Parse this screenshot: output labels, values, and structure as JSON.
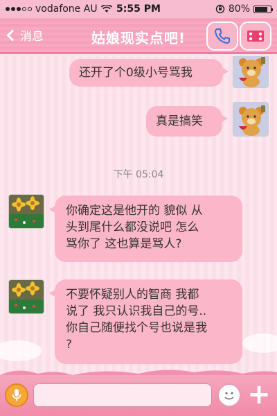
{
  "status_bar": {
    "carrier": "vodafone AU",
    "time": "5:55 PM",
    "battery_percent": "80%",
    "battery_level": 0.8,
    "signal_bars": 3,
    "signal_total": 5
  },
  "nav": {
    "back_label": "消息",
    "title": "姑娘现实点吧!"
  },
  "chat": {
    "timestamp": "下午 05:04",
    "messages": [
      {
        "side": "right",
        "text": "还开了个0级小号骂我"
      },
      {
        "side": "right",
        "text": "真是搞笑"
      },
      {
        "side": "left",
        "lines": [
          "你确定这是他开的 貌似 从",
          "头到尾什么都没说吧 怎么",
          "骂你了 这也算是骂人?"
        ]
      },
      {
        "side": "left",
        "lines": [
          "不要怀疑别人的智商  我都",
          "说了 我只认识我自己的号..",
          "你自己随便找个号也说是我",
          "?"
        ]
      }
    ]
  },
  "icons": {
    "back": "chevron-left-icon",
    "call": "phone-icon",
    "menu": "profile-card-icon",
    "mic": "microphone-icon",
    "emoji": "smiley-icon",
    "plus": "plus-icon"
  },
  "colors": {
    "accent_pink": "#f8a9c2",
    "bubble_pink": "#fbb7c9",
    "mic_orange": "#f6a73a"
  }
}
